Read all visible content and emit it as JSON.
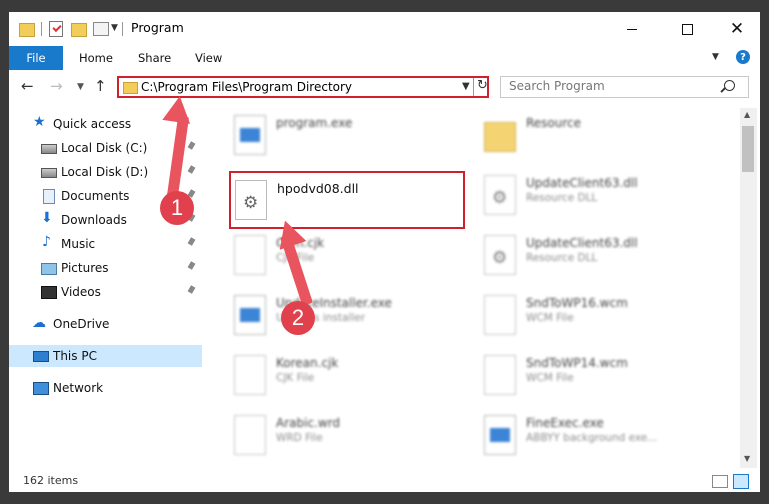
{
  "window": {
    "title": "Program"
  },
  "ribbon": {
    "file": "File",
    "home": "Home",
    "share": "Share",
    "view": "View",
    "help": "?"
  },
  "address": {
    "path": "C:\\Program Files\\Program Directory"
  },
  "search": {
    "placeholder": "Search Program"
  },
  "sidebar": {
    "items": [
      {
        "label": "Quick access",
        "icon": "quick-access-star-icon"
      },
      {
        "label": "Local Disk (C:)",
        "icon": "drive-icon"
      },
      {
        "label": "Local Disk (D:)",
        "icon": "drive-icon"
      },
      {
        "label": "Documents",
        "icon": "documents-icon"
      },
      {
        "label": "Downloads",
        "icon": "downloads-icon"
      },
      {
        "label": "Music",
        "icon": "music-icon"
      },
      {
        "label": "Pictures",
        "icon": "pictures-icon"
      },
      {
        "label": "Videos",
        "icon": "videos-icon"
      },
      {
        "label": "OneDrive",
        "icon": "onedrive-icon"
      },
      {
        "label": "This PC",
        "icon": "this-pc-icon"
      },
      {
        "label": "Network",
        "icon": "network-icon"
      }
    ],
    "selected": "This PC"
  },
  "files": [
    {
      "name": "program.exe",
      "type": ""
    },
    {
      "name": "Resource",
      "type": ""
    },
    {
      "name": "hpodvd08.dll",
      "type": ""
    },
    {
      "name": "UpdateClient63.dll",
      "type": "Resource DLL"
    },
    {
      "name": "Com.cjk",
      "type": "CJK File"
    },
    {
      "name": "UpdateClient63.dll",
      "type": "Resource DLL"
    },
    {
      "name": "UpdateInstaller.exe",
      "type": "Updates installer"
    },
    {
      "name": "SndToWP16.wcm",
      "type": "WCM File"
    },
    {
      "name": "Korean.cjk",
      "type": "CJK File"
    },
    {
      "name": "SndToWP14.wcm",
      "type": "WCM File"
    },
    {
      "name": "Arabic.wrd",
      "type": "WRD File"
    },
    {
      "name": "FineExec.exe",
      "type": "ABBYY background exe..."
    }
  ],
  "status": {
    "items_count": "162 items"
  },
  "annotations": {
    "step1": "1",
    "step2": "2"
  },
  "colors": {
    "highlight": "#d21f2c",
    "accent": "#1979ca"
  }
}
